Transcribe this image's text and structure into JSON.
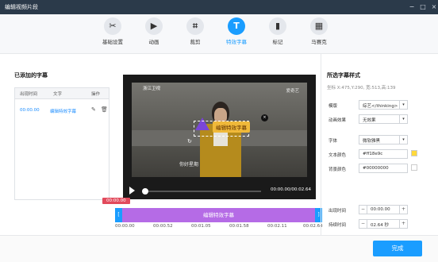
{
  "window": {
    "title": "编辑视频片段",
    "controls": [
      "−",
      "□",
      "×"
    ]
  },
  "toolbar": {
    "items": [
      {
        "id": "basic",
        "label": "基础设置",
        "icon": "scissors-icon",
        "glyph": "✂"
      },
      {
        "id": "anim",
        "label": "动画",
        "icon": "play-screen-icon",
        "glyph": "▶"
      },
      {
        "id": "crop",
        "label": "裁剪",
        "icon": "crop-icon",
        "glyph": "⌗"
      },
      {
        "id": "subtitle",
        "label": "特效字幕",
        "icon": "text-icon",
        "glyph": "T"
      },
      {
        "id": "mark",
        "label": "标记",
        "icon": "bookmark-icon",
        "glyph": "▮"
      },
      {
        "id": "mosaic",
        "label": "马赛克",
        "icon": "mosaic-icon",
        "glyph": "▦"
      }
    ],
    "active": "subtitle"
  },
  "left": {
    "heading": "已添加的字幕",
    "columns": [
      "出现时间",
      "文字",
      "操作"
    ],
    "rows": [
      {
        "time": "00:00.00",
        "text": "编辑特效字幕"
      }
    ]
  },
  "player": {
    "overlay_logo": "浙江卫视",
    "overlay_brand": "爱奇艺",
    "subtitle_text": "编辑特效字幕",
    "watermark": "你好星期",
    "time": "00:00.00/00:02.64"
  },
  "timeline": {
    "current": "00:00.00",
    "clip_label": "编辑特效字幕",
    "ticks": [
      "00:00.00",
      "00:00.52",
      "00:01.05",
      "00:01.58",
      "00:02.11",
      "00:02.64"
    ]
  },
  "right": {
    "heading": "所选字幕样式",
    "coords": "坐标 X:475,Y:290, 宽:513,高:139",
    "template_label": "模版",
    "template_value": "综艺</thinking>",
    "anim_label": "动画效果",
    "anim_value": "无效果",
    "font_label": "字体",
    "font_value": "微软雅黑",
    "textcolor_label": "文本颜色",
    "textcolor_value": "#ff18e9c",
    "textcolor_swatch": "#ffd83b",
    "bgcolor_label": "背景颜色",
    "bgcolor_value": "#00000000",
    "bgcolor_swatch": "#ffffff",
    "appear_label": "出现时间",
    "appear_value": "00:00.00",
    "duration_label": "持续时间",
    "duration_value": "02.64 秒"
  },
  "footer": {
    "done": "完成"
  }
}
